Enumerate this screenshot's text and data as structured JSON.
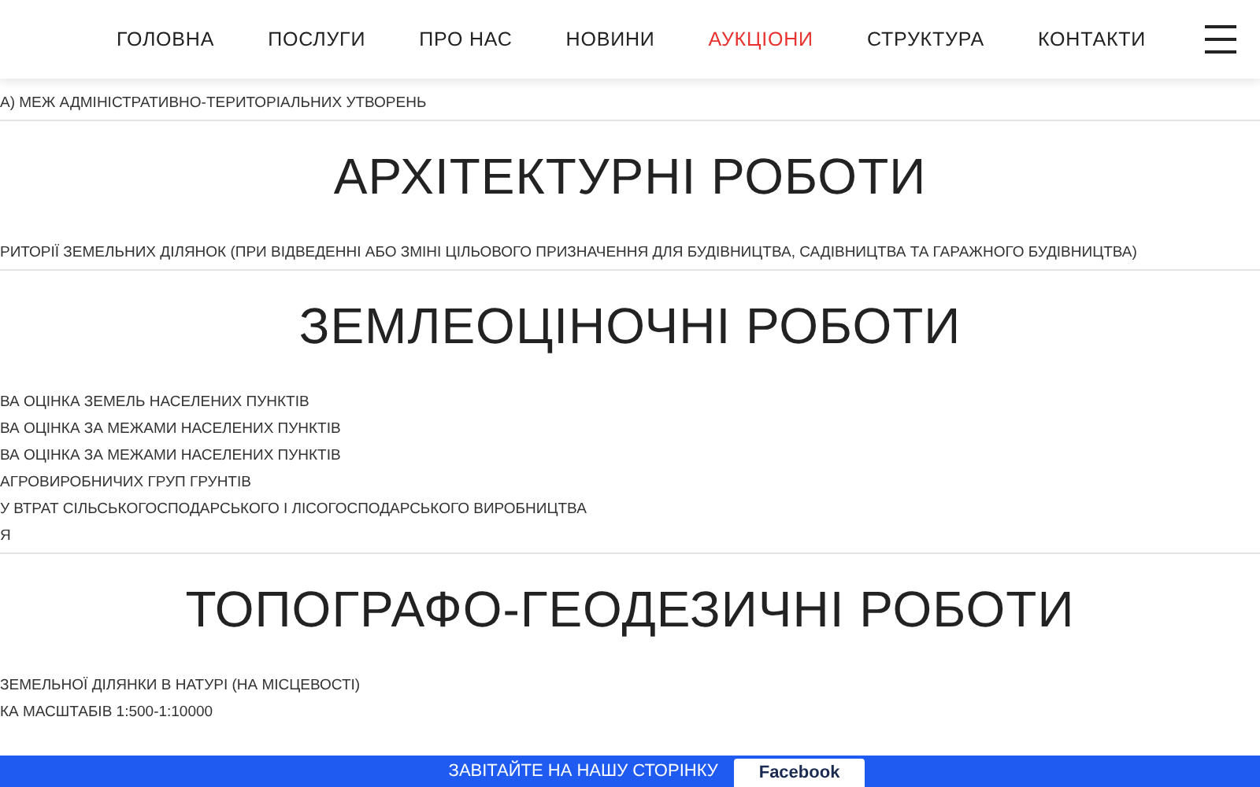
{
  "nav": {
    "items": [
      {
        "label": "ГОЛОВНА",
        "selected": false
      },
      {
        "label": "ПОСЛУГИ",
        "selected": false
      },
      {
        "label": "ПРО НАС",
        "selected": false
      },
      {
        "label": "НОВИНИ",
        "selected": false
      },
      {
        "label": "АУКЦІОНИ",
        "selected": true
      },
      {
        "label": "СТРУКТУРА",
        "selected": false
      },
      {
        "label": "КОНТАКТИ",
        "selected": false
      }
    ]
  },
  "lead_items": [
    "А) МЕЖ АДМІНІСТРАТИВНО-ТЕРИТОРІАЛЬНИХ УТВОРЕНЬ"
  ],
  "sections": [
    {
      "title": "АРХІТЕКТУРНІ РОБОТИ",
      "items": [
        "РИТОРІЇ ЗЕМЕЛЬНИХ ДІЛЯНОК (ПРИ ВІДВЕДЕННІ АБО ЗМІНІ ЦІЛЬОВОГО ПРИЗНАЧЕННЯ ДЛЯ БУДІВНИЦТВА, САДІВНИЦТВА ТА ГАРАЖНОГО БУДІВНИЦТВА)"
      ]
    },
    {
      "title": "ЗЕМЛЕОЦІНОЧНІ РОБОТИ",
      "items": [
        "ВА ОЦІНКА ЗЕМЕЛЬ НАСЕЛЕНИХ ПУНКТІВ",
        "ВА ОЦІНКА ЗА МЕЖАМИ НАСЕЛЕНИХ ПУНКТІВ",
        "ВА ОЦІНКА ЗА МЕЖАМИ НАСЕЛЕНИХ ПУНКТІВ",
        "АГРОВИРОБНИЧИХ ГРУП ГРУНТІВ",
        "У ВТРАТ СІЛЬСЬКОГОСПОДАРСЬКОГО І ЛІСОГОСПОДАРСЬКОГО ВИРОБНИЦТВА",
        "Я"
      ]
    },
    {
      "title": "ТОПОГРАФО-ГЕОДЕЗИЧНІ РОБОТИ",
      "items": [
        "ЗЕМЕЛЬНОЇ ДІЛЯНКИ В НАТУРІ (НА МІСЦЕВОСТІ)",
        "КА МАСШТАБІВ 1:500-1:10000"
      ]
    }
  ],
  "banner": {
    "text": "ЗАВІТАЙТЕ НА НАШУ СТОРІНКУ",
    "button": "Facebook"
  }
}
